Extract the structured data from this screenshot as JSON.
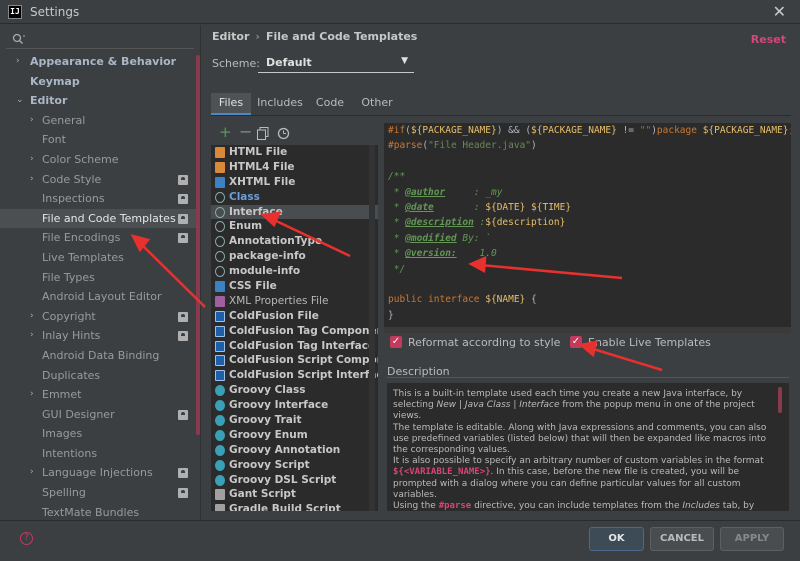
{
  "window": {
    "title": "Settings",
    "icon": "IJ"
  },
  "sidebar": {
    "search_placeholder": "",
    "items": [
      {
        "label": "Appearance & Behavior",
        "level": 0,
        "arrow": "›",
        "project": false
      },
      {
        "label": "Keymap",
        "level": 0,
        "arrow": "",
        "project": false
      },
      {
        "label": "Editor",
        "level": 0,
        "arrow": "⌄",
        "project": false
      },
      {
        "label": "General",
        "level": 1,
        "arrow": "›",
        "project": false
      },
      {
        "label": "Font",
        "level": 1,
        "arrow": "",
        "project": false
      },
      {
        "label": "Color Scheme",
        "level": 1,
        "arrow": "›",
        "project": false
      },
      {
        "label": "Code Style",
        "level": 1,
        "arrow": "›",
        "project": true
      },
      {
        "label": "Inspections",
        "level": 1,
        "arrow": "",
        "project": true
      },
      {
        "label": "File and Code Templates",
        "level": 1,
        "arrow": "",
        "project": true,
        "selected": true
      },
      {
        "label": "File Encodings",
        "level": 1,
        "arrow": "",
        "project": true
      },
      {
        "label": "Live Templates",
        "level": 1,
        "arrow": "",
        "project": false
      },
      {
        "label": "File Types",
        "level": 1,
        "arrow": "",
        "project": false
      },
      {
        "label": "Android Layout Editor",
        "level": 1,
        "arrow": "",
        "project": false
      },
      {
        "label": "Copyright",
        "level": 1,
        "arrow": "›",
        "project": true
      },
      {
        "label": "Inlay Hints",
        "level": 1,
        "arrow": "›",
        "project": true
      },
      {
        "label": "Android Data Binding",
        "level": 1,
        "arrow": "",
        "project": false
      },
      {
        "label": "Duplicates",
        "level": 1,
        "arrow": "",
        "project": false
      },
      {
        "label": "Emmet",
        "level": 1,
        "arrow": "›",
        "project": false
      },
      {
        "label": "GUI Designer",
        "level": 1,
        "arrow": "",
        "project": true
      },
      {
        "label": "Images",
        "level": 1,
        "arrow": "",
        "project": false
      },
      {
        "label": "Intentions",
        "level": 1,
        "arrow": "",
        "project": false
      },
      {
        "label": "Language Injections",
        "level": 1,
        "arrow": "›",
        "project": true
      },
      {
        "label": "Spelling",
        "level": 1,
        "arrow": "",
        "project": true
      },
      {
        "label": "TextMate Bundles",
        "level": 1,
        "arrow": "",
        "project": false
      }
    ]
  },
  "content": {
    "breadcrumb": [
      "Editor",
      "File and Code Templates"
    ],
    "breadcrumb_sep": "›",
    "reset_label": "Reset",
    "scheme_label": "Scheme:",
    "scheme_value": "Default",
    "tabs": [
      "Files",
      "Includes",
      "Code",
      "Other"
    ],
    "active_tab": "Files",
    "toolbar_icons": [
      "add-icon",
      "remove-icon",
      "copy-icon",
      "reset-icon"
    ],
    "templates": [
      {
        "label": "HTML File",
        "icon": "html"
      },
      {
        "label": "HTML4 File",
        "icon": "html"
      },
      {
        "label": "XHTML File",
        "icon": "css"
      },
      {
        "label": "Class",
        "icon": "java",
        "style": "blue"
      },
      {
        "label": "Interface",
        "icon": "java",
        "selected": true
      },
      {
        "label": "Enum",
        "icon": "java"
      },
      {
        "label": "AnnotationType",
        "icon": "java"
      },
      {
        "label": "package-info",
        "icon": "java"
      },
      {
        "label": "module-info",
        "icon": "java"
      },
      {
        "label": "CSS File",
        "icon": "css"
      },
      {
        "label": "XML Properties File",
        "icon": "xml",
        "style": "dim"
      },
      {
        "label": "ColdFusion File",
        "icon": "cf"
      },
      {
        "label": "ColdFusion Tag Component",
        "icon": "cf"
      },
      {
        "label": "ColdFusion Tag Interface",
        "icon": "cf"
      },
      {
        "label": "ColdFusion Script Component",
        "icon": "cf"
      },
      {
        "label": "ColdFusion Script Interface",
        "icon": "cf"
      },
      {
        "label": "Groovy Class",
        "icon": "groovy"
      },
      {
        "label": "Groovy Interface",
        "icon": "groovy"
      },
      {
        "label": "Groovy Trait",
        "icon": "groovy"
      },
      {
        "label": "Groovy Enum",
        "icon": "groovy"
      },
      {
        "label": "Groovy Annotation",
        "icon": "groovy"
      },
      {
        "label": "Groovy Script",
        "icon": "groovy"
      },
      {
        "label": "Groovy DSL Script",
        "icon": "groovy"
      },
      {
        "label": "Gant Script",
        "icon": "gant"
      },
      {
        "label": "Gradle Build Script",
        "icon": "gant"
      }
    ],
    "code_lines": [
      [
        [
          "kw",
          "#if"
        ],
        [
          "",
          "("
        ],
        [
          "var",
          "${PACKAGE_NAME}"
        ],
        [
          "",
          ") && "
        ],
        [
          "",
          "("
        ],
        [
          "var",
          "${PACKAGE_NAME}"
        ],
        [
          "",
          " != "
        ],
        [
          "str",
          "\"\""
        ],
        [
          "",
          ")"
        ],
        [
          "kw",
          "package "
        ],
        [
          "var",
          "${PACKAGE_NAME}"
        ],
        [
          "kw",
          ";#en"
        ]
      ],
      [
        [
          "kw",
          "#parse"
        ],
        [
          "",
          "("
        ],
        [
          "str",
          "\"File Header.java\""
        ],
        [
          "",
          ")"
        ]
      ],
      [
        [
          "",
          ""
        ]
      ],
      [
        [
          "cmt",
          "/**"
        ]
      ],
      [
        [
          "cmt",
          " * "
        ],
        [
          "tag",
          "@author"
        ],
        [
          "cmt",
          "     : _my"
        ]
      ],
      [
        [
          "cmt",
          " * "
        ],
        [
          "tag",
          "@date"
        ],
        [
          "cmt",
          "       : "
        ],
        [
          "var",
          "${DATE}"
        ],
        [
          "cmt",
          " "
        ],
        [
          "var",
          "${TIME}"
        ]
      ],
      [
        [
          "cmt",
          " * "
        ],
        [
          "tag",
          "@description"
        ],
        [
          "cmt",
          " :"
        ],
        [
          "var",
          "${description}"
        ]
      ],
      [
        [
          "cmt",
          " * "
        ],
        [
          "tag",
          "@modified"
        ],
        [
          "cmt",
          " By: `"
        ]
      ],
      [
        [
          "cmt",
          " * "
        ],
        [
          "tag",
          "@version:"
        ],
        [
          "cmt",
          "    1.0"
        ]
      ],
      [
        [
          "cmt",
          " */"
        ]
      ],
      [
        [
          "",
          ""
        ]
      ],
      [
        [
          "kw",
          "public interface "
        ],
        [
          "var",
          "${NAME}"
        ],
        [
          "",
          " {"
        ]
      ],
      [
        [
          "",
          "}"
        ]
      ]
    ],
    "reformat_label": "Reformat according to style",
    "live_templates_label": "Enable Live Templates",
    "description_title": "Description",
    "description": [
      {
        "text": "This is a built-in template used each time you create a new Java interface, by selecting "
      },
      {
        "text": "New | Java Class | Interface",
        "italic": true
      },
      {
        "text": " from the popup menu in one of the project views."
      }
    ],
    "description_p2": "The template is editable. Along with Java expressions and comments, you can also use predefined variables (listed below) that will then be expanded like macros into the corresponding values.",
    "description_p3a": "It is also possible to specify an arbitrary number of custom variables in the format ",
    "description_p3b": "${<VARIABLE_NAME>}",
    "description_p3c": ". In this case, before the new file is created, you will be prompted with a dialog where you can define particular values for all custom variables.",
    "description_p4a": "Using the ",
    "description_p4b": "#parse",
    "description_p4c": " directive, you can include templates from the ",
    "description_p4d": "Includes",
    "description_p4e": " tab, by"
  },
  "footer": {
    "ok": "OK",
    "cancel": "CANCEL",
    "apply": "APPLY",
    "help": "?"
  },
  "colors": {
    "accent": "#d7457a",
    "checkbox": "#c23a5c",
    "arrow": "#e8312f"
  }
}
